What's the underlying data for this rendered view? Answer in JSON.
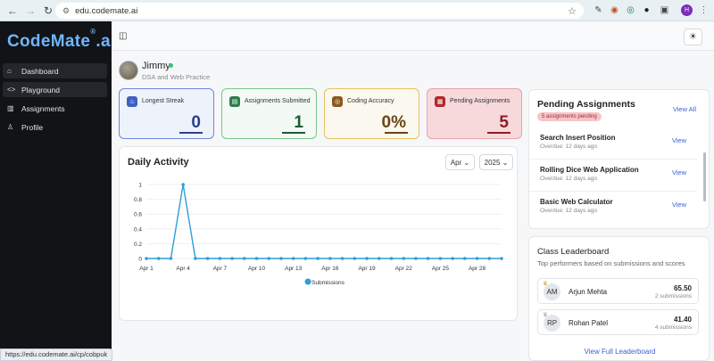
{
  "browser": {
    "url": "edu.codemate.ai",
    "status_url": "https://edu.codemate.ai/cp/cobpuk",
    "profile_initial": "H"
  },
  "sidebar": {
    "logo": "CodeMate",
    "logo_suffix": ".ai",
    "logo_mark": "®",
    "items": [
      {
        "label": "Dashboard",
        "icon": "home-icon"
      },
      {
        "label": "Playground",
        "icon": "code-icon"
      },
      {
        "label": "Assignments",
        "icon": "book-icon"
      },
      {
        "label": "Profile",
        "icon": "user-icon"
      }
    ]
  },
  "user": {
    "name": "Jimmy",
    "subtitle": "DSA and Web Practice"
  },
  "stats": [
    {
      "label": "Longest Streak",
      "value": "0",
      "color": "#3d5fc4"
    },
    {
      "label": "Assignments Submitted",
      "value": "1",
      "color": "#2e7d4a"
    },
    {
      "label": "Coding Accuracy",
      "value": "0%",
      "color": "#8a5a1c"
    },
    {
      "label": "Pending Assignments",
      "value": "5",
      "color": "#b3262e"
    }
  ],
  "activity": {
    "title": "Daily Activity",
    "month": "Apr",
    "year": "2025"
  },
  "chart_data": {
    "type": "line",
    "x": [
      "Apr 1",
      "Apr 2",
      "Apr 3",
      "Apr 4",
      "Apr 5",
      "Apr 6",
      "Apr 7",
      "Apr 8",
      "Apr 9",
      "Apr 10",
      "Apr 11",
      "Apr 12",
      "Apr 13",
      "Apr 14",
      "Apr 15",
      "Apr 16",
      "Apr 17",
      "Apr 18",
      "Apr 19",
      "Apr 20",
      "Apr 21",
      "Apr 22",
      "Apr 23",
      "Apr 24",
      "Apr 25",
      "Apr 26",
      "Apr 27",
      "Apr 28",
      "Apr 29",
      "Apr 30"
    ],
    "tick_labels": [
      "Apr 1",
      "Apr 4",
      "Apr 7",
      "Apr 10",
      "Apr 13",
      "Apr 16",
      "Apr 19",
      "Apr 22",
      "Apr 25",
      "Apr 28"
    ],
    "y_ticks": [
      "0",
      "0.2",
      "0.4",
      "0.6",
      "0.8",
      "1"
    ],
    "series": [
      {
        "name": "Submissions",
        "color": "#2f9ed6",
        "values": [
          0,
          0,
          0,
          1,
          0,
          0,
          0,
          0,
          0,
          0,
          0,
          0,
          0,
          0,
          0,
          0,
          0,
          0,
          0,
          0,
          0,
          0,
          0,
          0,
          0,
          0,
          0,
          0,
          0,
          0
        ]
      }
    ],
    "ylim": [
      0,
      1
    ],
    "grid": true,
    "legend": "bottom-center"
  },
  "pending": {
    "title": "Pending Assignments",
    "view_all": "View All",
    "badge": "5 assignments pending",
    "items": [
      {
        "name": "Search Insert Position",
        "due": "Overdue: 12 days ago",
        "action": "View"
      },
      {
        "name": "Rolling Dice Web Application",
        "due": "Overdue: 12 days ago",
        "action": "View"
      },
      {
        "name": "Basic Web Calculator",
        "due": "Overdue: 12 days ago",
        "action": "View"
      }
    ]
  },
  "leaderboard": {
    "title": "Class Leaderboard",
    "subtitle": "Top performers based on submissions and scores",
    "rows": [
      {
        "initials": "AM",
        "name": "Arjun Mehta",
        "score": "65.50",
        "count": "2 submissions",
        "medal": "#d4a520"
      },
      {
        "initials": "RP",
        "name": "Rohan Patel",
        "score": "41.40",
        "count": "4 submissions",
        "medal": "#9aa0a6"
      }
    ],
    "full_link": "View Full Leaderboard"
  }
}
